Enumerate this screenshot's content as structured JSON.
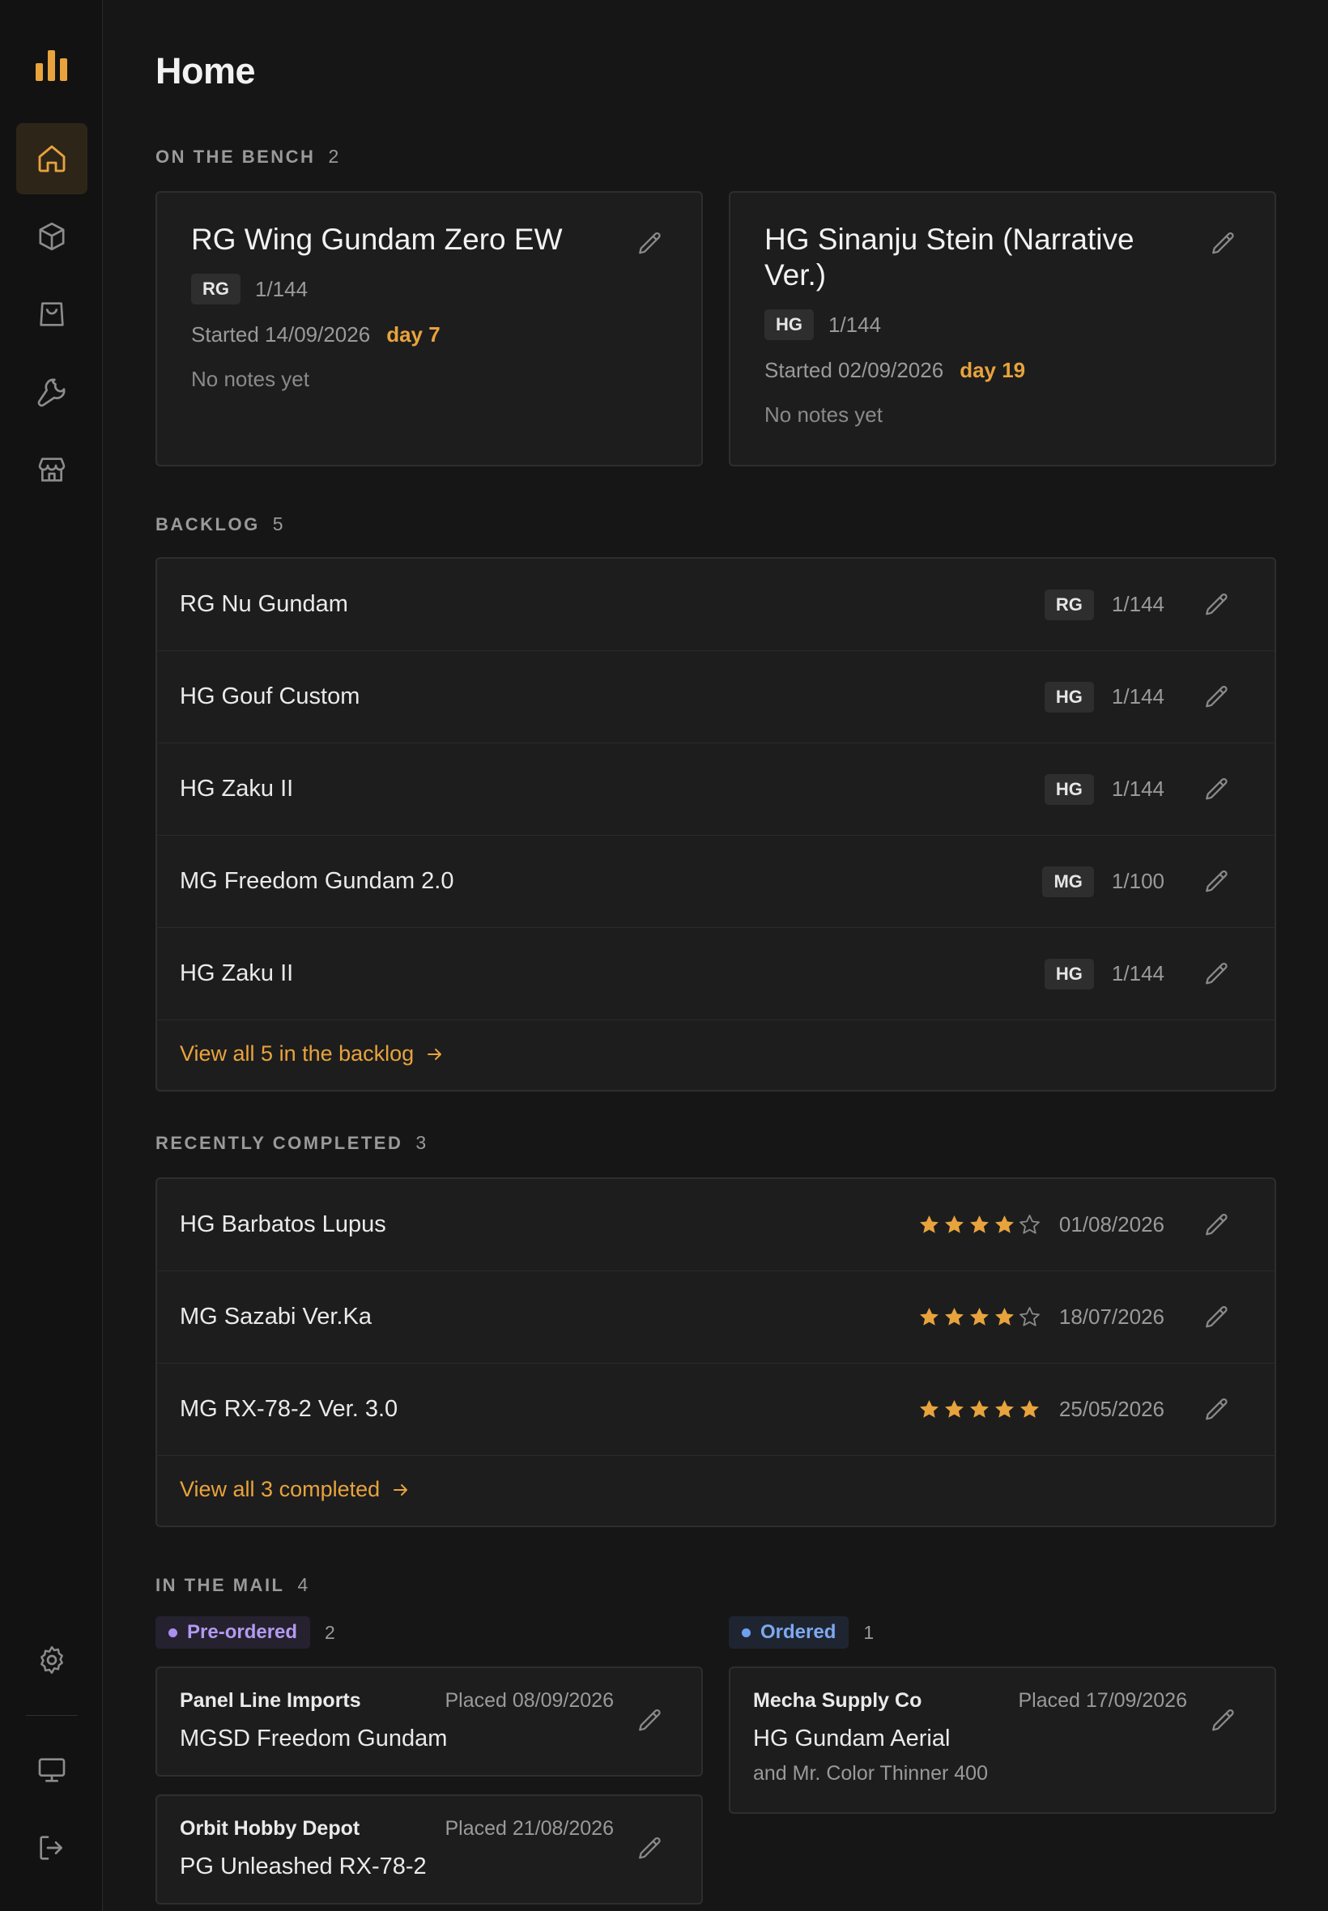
{
  "app": {
    "accent": "#e8a33d"
  },
  "sidebar": {
    "logo_icon": "bar-chart-icon",
    "items": [
      {
        "icon": "home-icon",
        "active": true
      },
      {
        "icon": "box-icon",
        "active": false
      },
      {
        "icon": "shopping-bag-icon",
        "active": false
      },
      {
        "icon": "wrench-icon",
        "active": false
      },
      {
        "icon": "store-icon",
        "active": false
      }
    ],
    "bottom": [
      {
        "icon": "gear-icon"
      },
      {
        "icon": "monitor-icon"
      },
      {
        "icon": "logout-icon"
      }
    ]
  },
  "page": {
    "title": "Home"
  },
  "bench": {
    "title": "ON THE BENCH",
    "count": "2",
    "cards": [
      {
        "name": "RG Wing Gundam Zero EW",
        "grade": "RG",
        "scale": "1/144",
        "started": "Started 14/09/2026",
        "day": "day 7",
        "notes": "No notes yet"
      },
      {
        "name": "HG Sinanju Stein (Narrative Ver.)",
        "grade": "HG",
        "scale": "1/144",
        "started": "Started 02/09/2026",
        "day": "day 19",
        "notes": "No notes yet"
      }
    ]
  },
  "backlog": {
    "title": "BACKLOG",
    "count": "5",
    "items": [
      {
        "name": "RG Nu Gundam",
        "grade": "RG",
        "scale": "1/144"
      },
      {
        "name": "HG Gouf Custom",
        "grade": "HG",
        "scale": "1/144"
      },
      {
        "name": "HG Zaku II",
        "grade": "HG",
        "scale": "1/144"
      },
      {
        "name": "MG Freedom Gundam 2.0",
        "grade": "MG",
        "scale": "1/100"
      },
      {
        "name": "HG Zaku II",
        "grade": "HG",
        "scale": "1/144"
      }
    ],
    "view_all": "View all 5 in the backlog"
  },
  "completed": {
    "title": "RECENTLY COMPLETED",
    "count": "3",
    "items": [
      {
        "name": "HG Barbatos Lupus",
        "rating": 4,
        "date": "01/08/2026"
      },
      {
        "name": "MG Sazabi Ver.Ka",
        "rating": 4,
        "date": "18/07/2026"
      },
      {
        "name": "MG RX-78-2 Ver. 3.0",
        "rating": 5,
        "date": "25/05/2026"
      }
    ],
    "view_all": "View all 3 completed"
  },
  "mail": {
    "title": "IN THE MAIL",
    "count": "4",
    "preordered": {
      "label": "Pre-ordered",
      "count": "2",
      "orders": [
        {
          "store": "Panel Line Imports",
          "placed": "Placed 08/09/2026",
          "item": "MGSD Freedom Gundam"
        },
        {
          "store": "Orbit Hobby Depot",
          "placed": "Placed 21/08/2026",
          "item": "PG Unleashed RX-78-2"
        }
      ]
    },
    "ordered": {
      "label": "Ordered",
      "count": "1",
      "orders": [
        {
          "store": "Mecha Supply Co",
          "placed": "Placed 17/09/2026",
          "item": "HG Gundam Aerial",
          "extra": "and Mr. Color Thinner 400"
        }
      ]
    }
  }
}
